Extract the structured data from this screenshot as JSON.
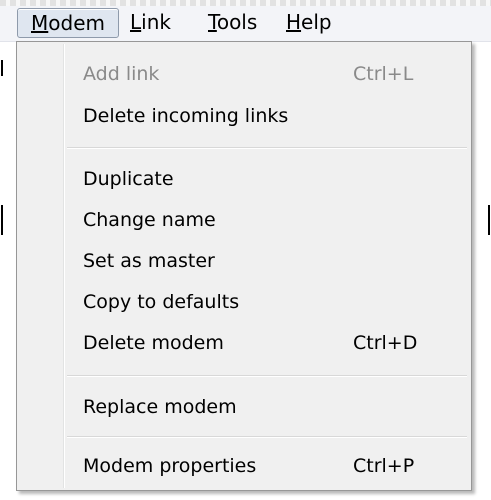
{
  "menubar": {
    "items": [
      {
        "pre": "",
        "mnemonic": "M",
        "post": "odem"
      },
      {
        "pre": "",
        "mnemonic": "L",
        "post": "ink"
      },
      {
        "pre": "",
        "mnemonic": "T",
        "post": "ools"
      },
      {
        "pre": "",
        "mnemonic": "H",
        "post": "elp"
      }
    ],
    "active_index": 0
  },
  "dropdown": {
    "items": [
      {
        "label": "Add link",
        "shortcut": "Ctrl+L",
        "enabled": false
      },
      {
        "label": "Delete incoming links",
        "shortcut": "",
        "enabled": true
      },
      {
        "label": "Duplicate",
        "shortcut": "",
        "enabled": true
      },
      {
        "label": "Change name",
        "shortcut": "",
        "enabled": true
      },
      {
        "label": "Set as master",
        "shortcut": "",
        "enabled": true
      },
      {
        "label": "Copy to defaults",
        "shortcut": "",
        "enabled": true
      },
      {
        "label": "Delete modem",
        "shortcut": "Ctrl+D",
        "enabled": true
      },
      {
        "label": "Replace modem",
        "shortcut": "",
        "enabled": true
      },
      {
        "label": "Modem properties",
        "shortcut": "Ctrl+P",
        "enabled": true
      }
    ]
  },
  "colors": {
    "menu_background": "#f0f0f0",
    "disabled_text": "#8a8a8a",
    "active_menubar_highlight": "#dfe6f0"
  }
}
